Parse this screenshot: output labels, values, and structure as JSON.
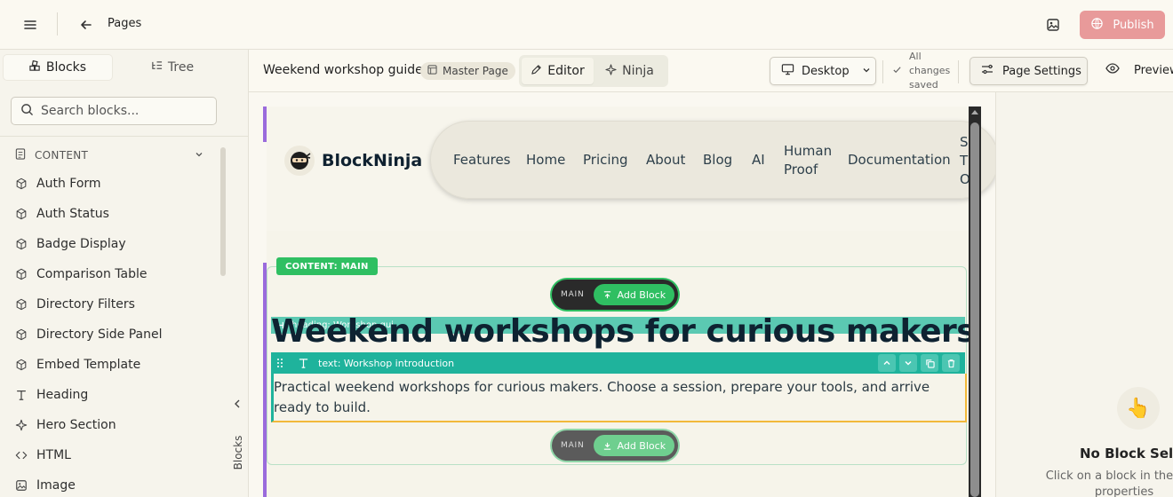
{
  "topbar": {
    "title": "Pages",
    "publish_label": "Publish",
    "icons": [
      "menu-icon",
      "arrow-left-icon",
      "image-icon",
      "globe-icon"
    ]
  },
  "sidebar": {
    "tabs": [
      {
        "label": "Blocks",
        "icon": "blocks-icon",
        "active": true
      },
      {
        "label": "Tree",
        "icon": "tree-icon",
        "active": false
      }
    ],
    "search_placeholder": "Search blocks...",
    "group": "CONTENT",
    "items": [
      {
        "label": "Auth Form",
        "icon": "cube-icon"
      },
      {
        "label": "Auth Status",
        "icon": "cube-icon"
      },
      {
        "label": "Badge Display",
        "icon": "cube-icon"
      },
      {
        "label": "Comparison Table",
        "icon": "cube-icon"
      },
      {
        "label": "Directory Filters",
        "icon": "cube-icon"
      },
      {
        "label": "Directory Side Panel",
        "icon": "cube-icon"
      },
      {
        "label": "Embed Template",
        "icon": "cube-icon"
      },
      {
        "label": "Heading",
        "icon": "type-icon"
      },
      {
        "label": "Hero Section",
        "icon": "sparkle-icon"
      },
      {
        "label": "HTML",
        "icon": "code-icon"
      },
      {
        "label": "Image",
        "icon": "image-icon"
      }
    ],
    "rail_label": "Blocks"
  },
  "editor": {
    "page_name": "Weekend workshop guide:",
    "master_label": "Master Page",
    "modes": [
      {
        "label": "Editor",
        "active": true
      },
      {
        "label": "Ninja",
        "active": false
      }
    ],
    "device": "Desktop",
    "saved_status": "All changes saved",
    "settings_label": "Page Settings",
    "preview_label": "Preview"
  },
  "canvas": {
    "site": {
      "brand": "BlockNinja",
      "nav": [
        "Features",
        "Home",
        "Pricing",
        "About",
        "Blog",
        "AI",
        "Human Proof",
        "Documentation",
        "S T O"
      ]
    },
    "area_label": "CONTENT: MAIN",
    "add_top": {
      "key": "MAIN",
      "label": "Add Block"
    },
    "add_bottom": {
      "key": "MAIN",
      "label": "Add Block"
    },
    "heading_bar_label": "heading: Workshop gui...",
    "heading_text": "Weekend workshops for curious makers",
    "text_bar_label": "text: Workshop introduction",
    "paragraph": "Practical weekend workshops for curious makers. Choose a session, prepare your tools, and arrive ready to build."
  },
  "right_panel": {
    "title": "No Block Selec",
    "subtitle": "Click on a block in the prev properties"
  },
  "colors": {
    "accent_green": "#2fbf62",
    "teal": "#1fb39c",
    "purple": "#9a6bdc",
    "publish": "#e89a9a",
    "selection": "#f2b93a"
  }
}
